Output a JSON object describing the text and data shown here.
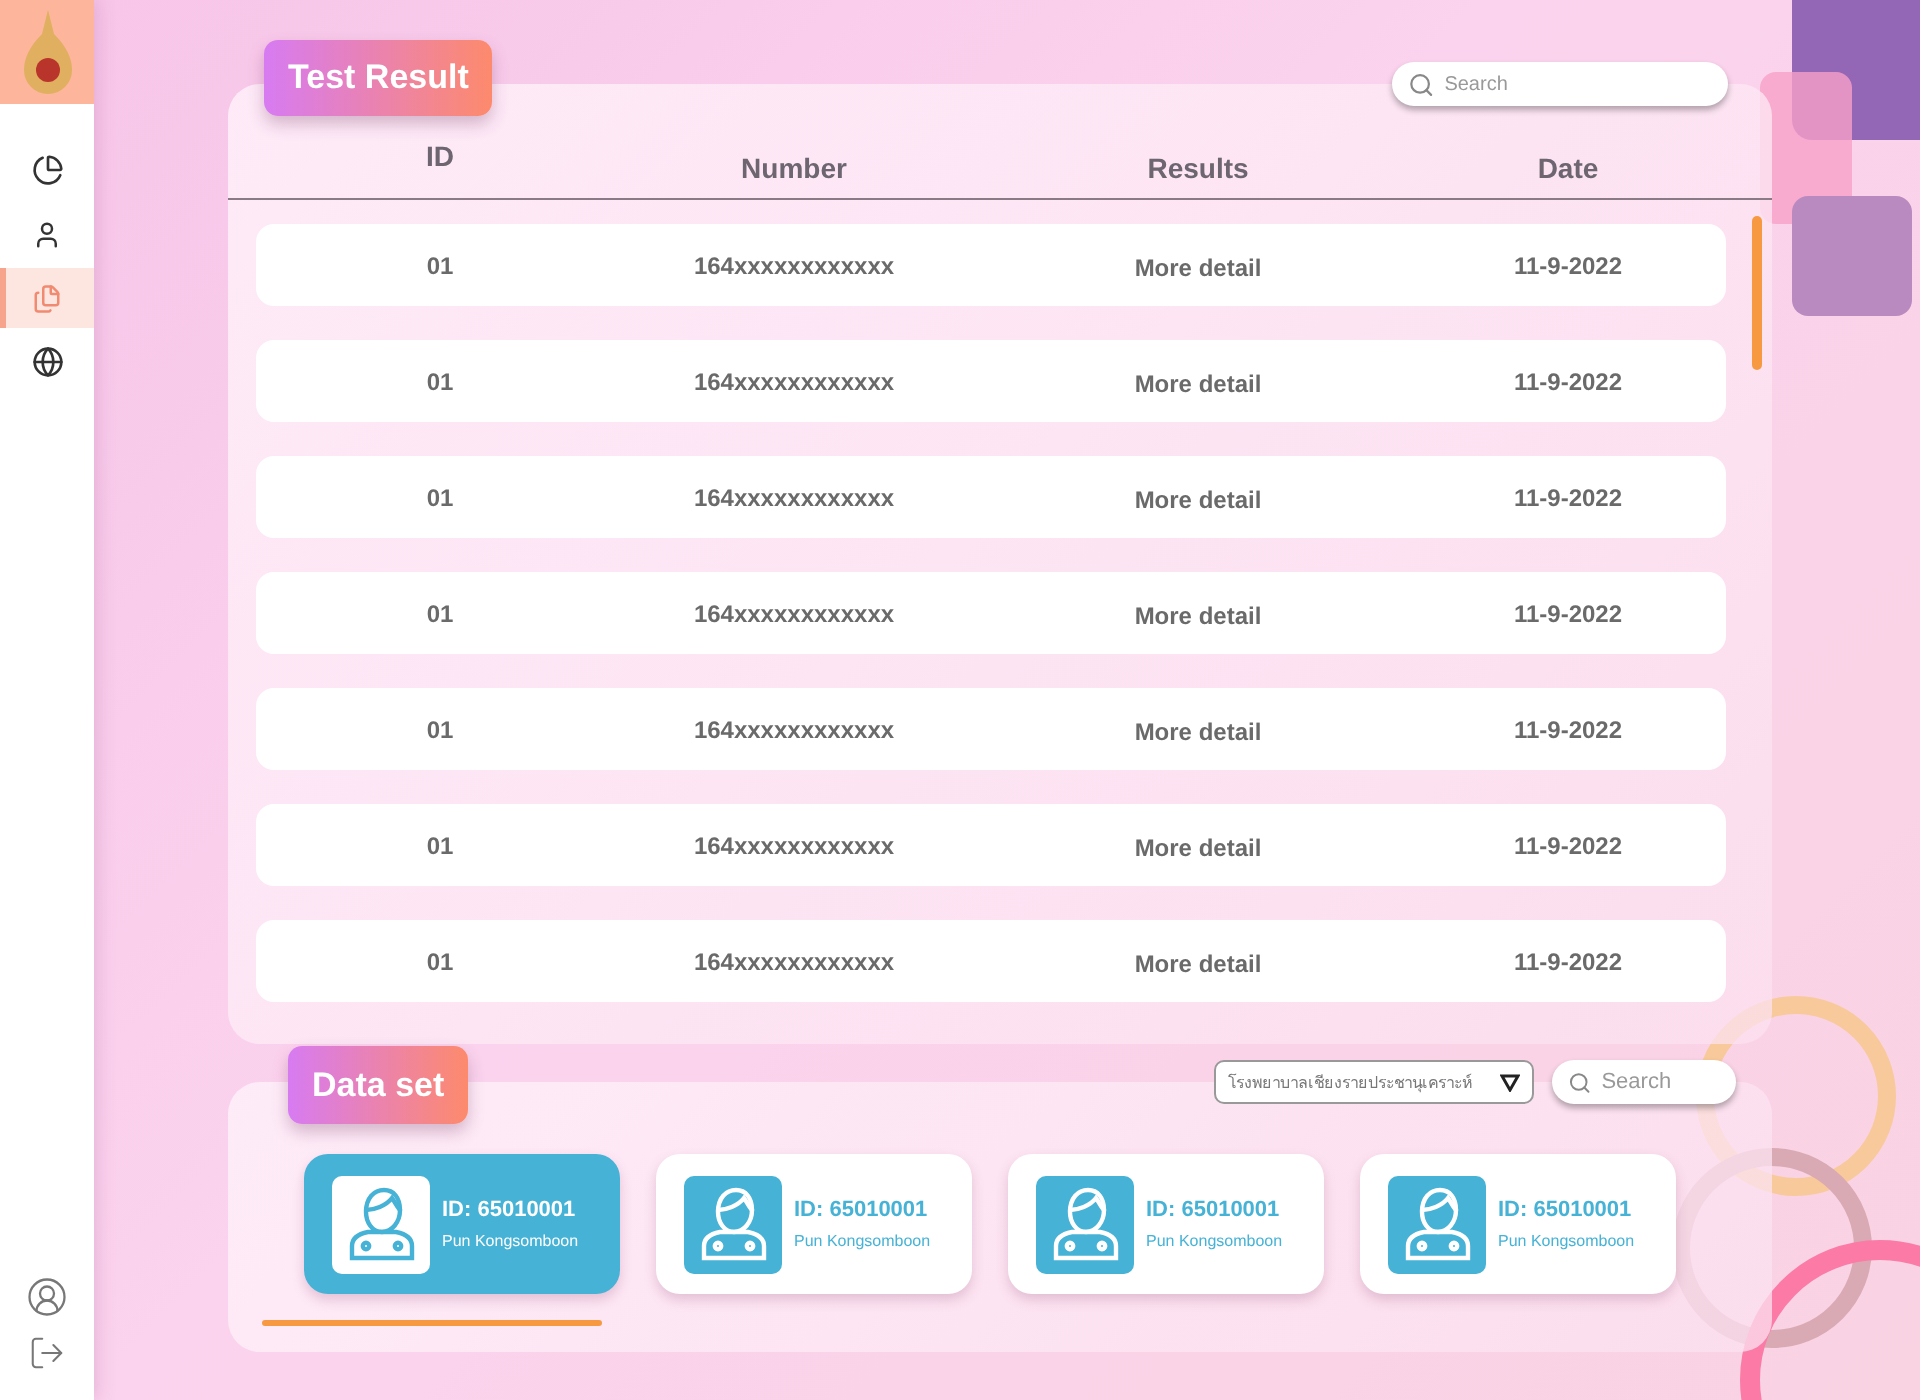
{
  "sidebar": {
    "items": [
      {
        "kind": "chart",
        "selected": false
      },
      {
        "kind": "user",
        "selected": false
      },
      {
        "kind": "document",
        "selected": true
      },
      {
        "kind": "globe-settings",
        "selected": false
      }
    ],
    "bottom_items": [
      {
        "kind": "profile"
      },
      {
        "kind": "logout"
      }
    ]
  },
  "test_result": {
    "title": "Test Result",
    "search": {
      "placeholder": "Search"
    },
    "columns": [
      "ID",
      "Number",
      "Results",
      "Date"
    ],
    "rows": [
      {
        "id": "01",
        "number": "164xxxxxxxxxxxx",
        "results": "More detail",
        "date": "11-9-2022"
      },
      {
        "id": "01",
        "number": "164xxxxxxxxxxxx",
        "results": "More detail",
        "date": "11-9-2022"
      },
      {
        "id": "01",
        "number": "164xxxxxxxxxxxx",
        "results": "More detail",
        "date": "11-9-2022"
      },
      {
        "id": "01",
        "number": "164xxxxxxxxxxxx",
        "results": "More detail",
        "date": "11-9-2022"
      },
      {
        "id": "01",
        "number": "164xxxxxxxxxxxx",
        "results": "More detail",
        "date": "11-9-2022"
      },
      {
        "id": "01",
        "number": "164xxxxxxxxxxxx",
        "results": "More detail",
        "date": "11-9-2022"
      },
      {
        "id": "01",
        "number": "164xxxxxxxxxxxx",
        "results": "More detail",
        "date": "11-9-2022"
      }
    ]
  },
  "data_set": {
    "title": "Data set",
    "hospital_select": {
      "value": "โรงพยาบาลเชียงรายประชานุเคราะห์"
    },
    "search": {
      "placeholder": "Search"
    },
    "cards": [
      {
        "id": "ID: 65010001",
        "name": "Pun Kongsomboon",
        "selected": true
      },
      {
        "id": "ID: 65010001",
        "name": "Pun Kongsomboon",
        "selected": false
      },
      {
        "id": "ID: 65010001",
        "name": "Pun Kongsomboon",
        "selected": false
      },
      {
        "id": "ID: 65010001",
        "name": "Pun Kongsomboon",
        "selected": false
      }
    ]
  }
}
